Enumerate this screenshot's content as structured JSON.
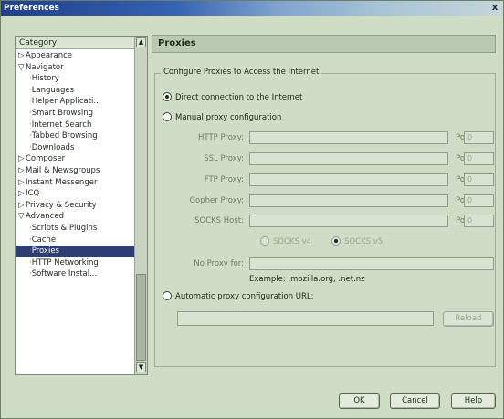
{
  "window": {
    "title": "Preferences",
    "close_glyph": "x"
  },
  "category": {
    "header": "Category",
    "items": [
      {
        "label": "Appearance",
        "level": 0,
        "twisty": "▷"
      },
      {
        "label": "Navigator",
        "level": 0,
        "twisty": "▽"
      },
      {
        "label": "History",
        "level": 1
      },
      {
        "label": "Languages",
        "level": 1
      },
      {
        "label": "Helper Applicati...",
        "level": 1
      },
      {
        "label": "Smart Browsing",
        "level": 1
      },
      {
        "label": "Internet Search",
        "level": 1
      },
      {
        "label": "Tabbed Browsing",
        "level": 1
      },
      {
        "label": "Downloads",
        "level": 1
      },
      {
        "label": "Composer",
        "level": 0,
        "twisty": "▷"
      },
      {
        "label": "Mail & Newsgroups",
        "level": 0,
        "twisty": "▷"
      },
      {
        "label": "Instant Messenger",
        "level": 0,
        "twisty": "▷"
      },
      {
        "label": "ICQ",
        "level": 0,
        "twisty": "▷"
      },
      {
        "label": "Privacy & Security",
        "level": 0,
        "twisty": "▷"
      },
      {
        "label": "Advanced",
        "level": 0,
        "twisty": "▽"
      },
      {
        "label": "Scripts & Plugins",
        "level": 1
      },
      {
        "label": "Cache",
        "level": 1
      },
      {
        "label": "Proxies",
        "level": 1,
        "selected": true
      },
      {
        "label": "HTTP Networking",
        "level": 1
      },
      {
        "label": "Software Instal...",
        "level": 1
      }
    ]
  },
  "panel": {
    "title": "Proxies",
    "group_label": "Configure Proxies to Access the Internet",
    "direct_label": "Direct connection to the Internet",
    "manual_label": "Manual proxy configuration",
    "auto_label": "Automatic proxy configuration URL:",
    "selected_mode": "direct",
    "fields": {
      "http": {
        "label": "HTTP Proxy:",
        "value": "",
        "port_label": "Port:",
        "port": "0"
      },
      "ssl": {
        "label": "SSL Proxy:",
        "value": "",
        "port_label": "Port:",
        "port": "0"
      },
      "ftp": {
        "label": "FTP Proxy:",
        "value": "",
        "port_label": "Port:",
        "port": "0"
      },
      "gopher": {
        "label": "Gopher Proxy:",
        "value": "",
        "port_label": "Port:",
        "port": "0"
      },
      "socks": {
        "label": "SOCKS Host:",
        "value": "",
        "port_label": "Port:",
        "port": "0"
      }
    },
    "socks_v4": "SOCKS v4",
    "socks_v5": "SOCKS v5",
    "no_proxy_label": "No Proxy for:",
    "no_proxy_value": "",
    "example": "Example: .mozilla.org, .net.nz",
    "auto_url": "",
    "reload_label": "Reload"
  },
  "buttons": {
    "ok": "OK",
    "cancel": "Cancel",
    "help": "Help"
  }
}
